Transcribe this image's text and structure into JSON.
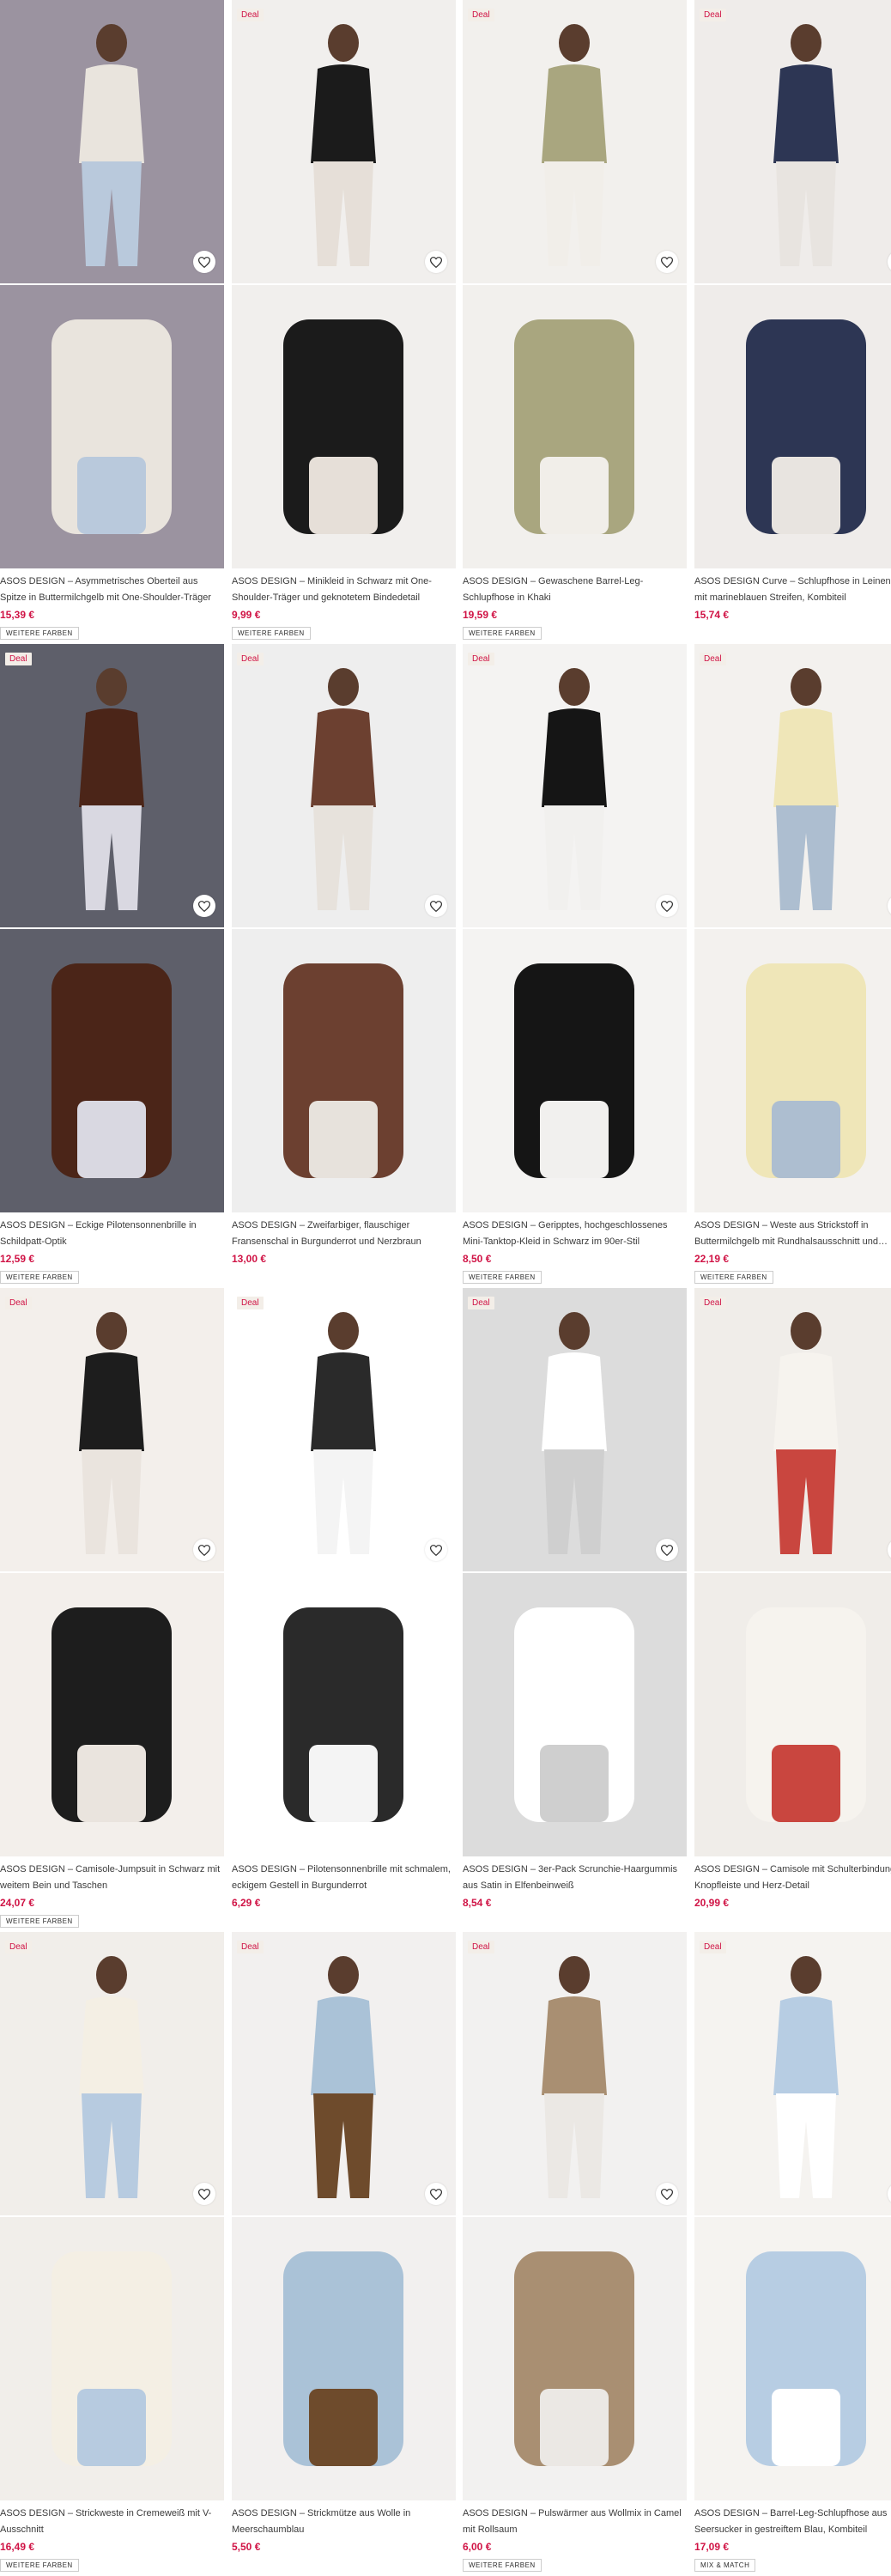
{
  "accent_color": "#d01345",
  "deal_label": "Deal",
  "products": [
    {
      "title": "ASOS DESIGN – Asymmetrisches Oberteil aus Spitze in Buttermilchgelb mit One-Shoulder-Träger",
      "price": "15,39 €",
      "deal": false,
      "tag": "WEITERE FARBEN",
      "colors": [
        "#9b93a0",
        "#e9e4dd",
        "#b9c9dc"
      ]
    },
    {
      "title": "ASOS DESIGN – Minikleid in Schwarz mit One-Shoulder-Träger und geknotetem Bindedetail",
      "price": "9,99 €",
      "deal": true,
      "tag": "WEITERE FARBEN",
      "colors": [
        "#f1efed",
        "#1b1b1b",
        "#e6dfd8"
      ]
    },
    {
      "title": "ASOS DESIGN – Gewaschene Barrel-Leg-Schlupfhose in Khaki",
      "price": "19,59 €",
      "deal": true,
      "tag": "WEITERE FARBEN",
      "colors": [
        "#f2f0ed",
        "#a9a67f",
        "#f1eee9"
      ]
    },
    {
      "title": "ASOS DESIGN Curve – Schlupfhose in Leinenoptik mit marineblauen Streifen, Kombiteil",
      "price": "15,74 €",
      "deal": true,
      "tag": "",
      "colors": [
        "#efecea",
        "#2d3654",
        "#e8e4e0"
      ]
    },
    {
      "title": "ASOS DESIGN – Eckige Pilotensonnenbrille in Schildpatt-Optik",
      "price": "12,59 €",
      "deal": true,
      "tag": "WEITERE FARBEN",
      "colors": [
        "#5e5f6a",
        "#4b2518",
        "#d9d8e1"
      ]
    },
    {
      "title": "ASOS DESIGN – Zweifarbiger, flauschiger Fransenschal in Burgunderrot und Nerzbraun",
      "price": "13,00 €",
      "deal": true,
      "tag": "",
      "colors": [
        "#eeeeee",
        "#6c4030",
        "#e7e2dc"
      ]
    },
    {
      "title": "ASOS DESIGN – Geripptes, hochgeschlossenes Mini-Tanktop-Kleid in Schwarz im 90er-Stil",
      "price": "8,50 €",
      "deal": true,
      "tag": "WEITERE FARBEN",
      "colors": [
        "#f4f3f2",
        "#151515",
        "#f1f0ee"
      ]
    },
    {
      "title": "ASOS DESIGN – Weste aus Strickstoff in Buttermilchgelb mit Rundhalsausschnitt und…",
      "price": "22,19 €",
      "deal": true,
      "tag": "WEITERE FARBEN",
      "colors": [
        "#f3f1ee",
        "#efe6b8",
        "#adbed0"
      ]
    },
    {
      "title": "ASOS DESIGN – Camisole-Jumpsuit in Schwarz mit weitem Bein und Taschen",
      "price": "24,07 €",
      "deal": true,
      "tag": "WEITERE FARBEN",
      "colors": [
        "#f3efeb",
        "#1d1d1d",
        "#eae4de"
      ]
    },
    {
      "title": "ASOS DESIGN – Pilotensonnenbrille mit schmalem, eckigem Gestell in Burgunderrot",
      "price": "6,29 €",
      "deal": true,
      "tag": "",
      "colors": [
        "#ffffff",
        "#2a2a2a",
        "#f4f4f4"
      ]
    },
    {
      "title": "ASOS DESIGN – 3er-Pack Scrunchie-Haargummis aus Satin in Elfenbeinweiß",
      "price": "8,54 €",
      "deal": true,
      "tag": "",
      "colors": [
        "#dcdcdc",
        "#ffffff",
        "#cfcfcf"
      ]
    },
    {
      "title": "ASOS DESIGN – Camisole mit Schulterbindung, Knopfleiste und Herz-Detail",
      "price": "20,99 €",
      "deal": true,
      "tag": "",
      "colors": [
        "#f0ede9",
        "#f6f3ee",
        "#c9463f"
      ]
    },
    {
      "title": "ASOS DESIGN – Strickweste in Cremeweiß mit V-Ausschnitt",
      "price": "16,49 €",
      "deal": true,
      "tag": "WEITERE FARBEN",
      "colors": [
        "#f1eeea",
        "#f4efe4",
        "#b7cbe0"
      ]
    },
    {
      "title": "ASOS DESIGN – Strickmütze aus Wolle in Meerschaumblau",
      "price": "5,50 €",
      "deal": true,
      "tag": "",
      "colors": [
        "#f2f0ef",
        "#aac2d7",
        "#6e4b2c"
      ]
    },
    {
      "title": "ASOS DESIGN – Pulswärmer aus Wollmix in Camel mit Rollsaum",
      "price": "6,00 €",
      "deal": true,
      "tag": "WEITERE FARBEN",
      "colors": [
        "#f2f1f0",
        "#a98f72",
        "#ebe8e4"
      ]
    },
    {
      "title": "ASOS DESIGN – Barrel-Leg-Schlupfhose aus Seersucker in gestreiftem Blau, Kombiteil",
      "price": "17,09 €",
      "deal": true,
      "tag": "MIX & MATCH",
      "colors": [
        "#f5f3f0",
        "#b7cde3",
        "#ffffff"
      ]
    }
  ]
}
